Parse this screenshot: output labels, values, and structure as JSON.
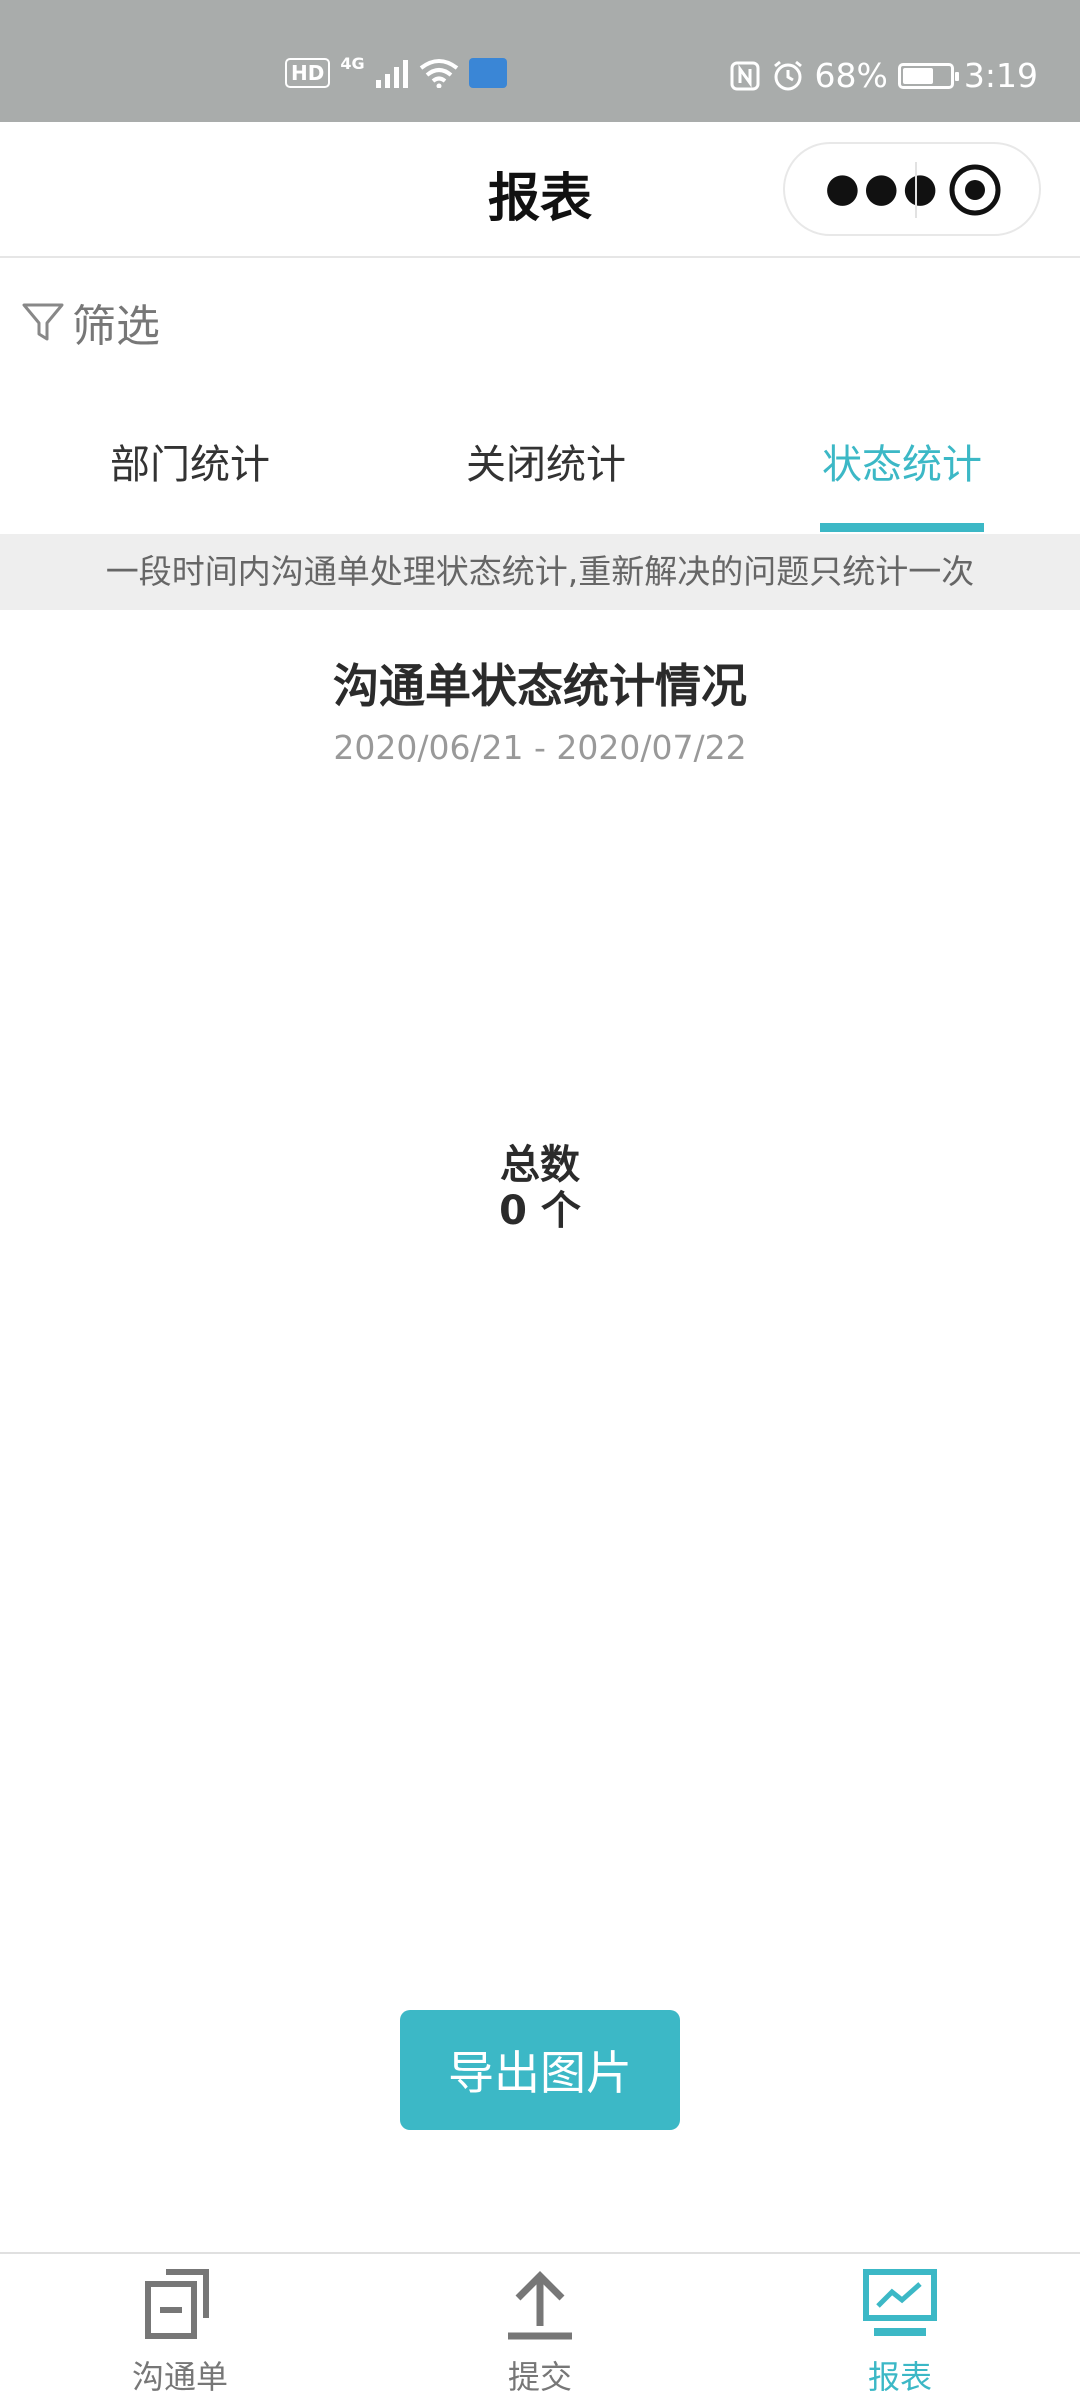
{
  "status_bar": {
    "hd": "HD",
    "network": "4G",
    "battery_percent": "68%",
    "battery_level": 0.68,
    "time": "3:19",
    "nfc_icon": "nfc-icon",
    "alarm_icon": "alarm-icon",
    "wifi_icon": "wifi-icon",
    "signal_icon": "signal-icon"
  },
  "header": {
    "title": "报表",
    "more_icon": "more-dots-icon",
    "close_icon": "target-circle-icon"
  },
  "filter": {
    "icon": "filter-funnel-icon",
    "label": "筛选"
  },
  "tabs": [
    {
      "label": "部门统计",
      "active": false
    },
    {
      "label": "关闭统计",
      "active": false
    },
    {
      "label": "状态统计",
      "active": true
    }
  ],
  "notice": "一段时间内沟通单处理状态统计,重新解决的问题只统计一次",
  "report": {
    "title": "沟通单状态统计情况",
    "date_range": "2020/06/21 - 2020/07/22",
    "total_label": "总数",
    "total_value": "0 个"
  },
  "export_button": "导出图片",
  "tabbar": [
    {
      "label": "沟通单",
      "icon": "document-copy-icon",
      "active": false
    },
    {
      "label": "提交",
      "icon": "upload-arrow-icon",
      "active": false
    },
    {
      "label": "报表",
      "icon": "chart-monitor-icon",
      "active": true
    }
  ],
  "colors": {
    "accent": "#3cb8c6",
    "status_bar": "#a9acab",
    "notice_bg": "#eeeeee"
  }
}
